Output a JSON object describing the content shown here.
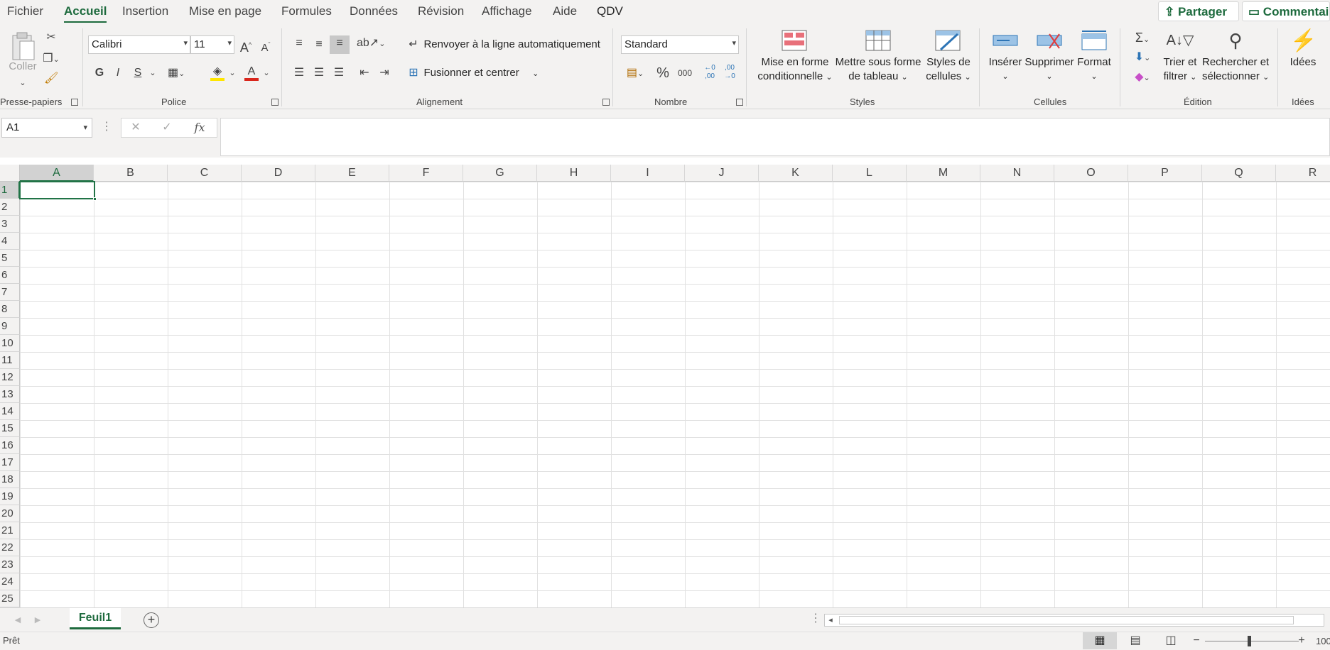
{
  "tabs": [
    "Fichier",
    "Accueil",
    "Insertion",
    "Mise en page",
    "Formules",
    "Données",
    "Révision",
    "Affichage",
    "Aide",
    "QDV"
  ],
  "header": {
    "share_label": "Partager",
    "comments_label": "Commentaires"
  },
  "ribbon": {
    "clipboard": {
      "group": "Presse-papiers",
      "paste_label": "Coller"
    },
    "font": {
      "group": "Police",
      "font_name": "Calibri",
      "font_size": "11",
      "bold": "G",
      "italic": "I",
      "underline": "S",
      "font_color": "#d9261c",
      "highlight_color": "#ffe600"
    },
    "alignment": {
      "group": "Alignement",
      "wrap_label": "Renvoyer à la ligne automatiquement",
      "merge_label": "Fusionner et centrer"
    },
    "number": {
      "group": "Nombre",
      "format": "Standard",
      "percent": "%",
      "thousands": "000",
      "inc_dec": "←0 ,00",
      "dec_dec": ",00 →0"
    },
    "styles": {
      "group": "Styles",
      "cond_format_l1": "Mise en forme",
      "cond_format_l2": "conditionnelle",
      "table_l1": "Mettre sous forme",
      "table_l2": "de tableau",
      "cell_styles_l1": "Styles de",
      "cell_styles_l2": "cellules"
    },
    "cells": {
      "group": "Cellules",
      "insert": "Insérer",
      "delete": "Supprimer",
      "format": "Format"
    },
    "editing": {
      "group": "Édition",
      "sort_l1": "Trier et",
      "sort_l2": "filtrer",
      "find_l1": "Rechercher et",
      "find_l2": "sélectionner"
    },
    "ideas": {
      "group": "Idées",
      "label": "Idées"
    }
  },
  "formula_bar": {
    "name_box": "A1",
    "fx": "fx"
  },
  "columns": [
    "A",
    "B",
    "C",
    "D",
    "E",
    "F",
    "G",
    "H",
    "I",
    "J",
    "K",
    "L",
    "M",
    "N",
    "O",
    "P",
    "Q",
    "R"
  ],
  "rows": [
    "1",
    "2",
    "3",
    "4",
    "5",
    "6",
    "7",
    "8",
    "9",
    "10",
    "11",
    "12",
    "13",
    "14",
    "15",
    "16",
    "17",
    "18",
    "19",
    "20",
    "21",
    "22",
    "23",
    "24",
    "25"
  ],
  "sheet": {
    "tab_name": "Feuil1"
  },
  "status": {
    "text": "Prêt",
    "zoom": "100"
  },
  "colors": {
    "accent": "#1e6b3e",
    "selection": "#217346"
  }
}
